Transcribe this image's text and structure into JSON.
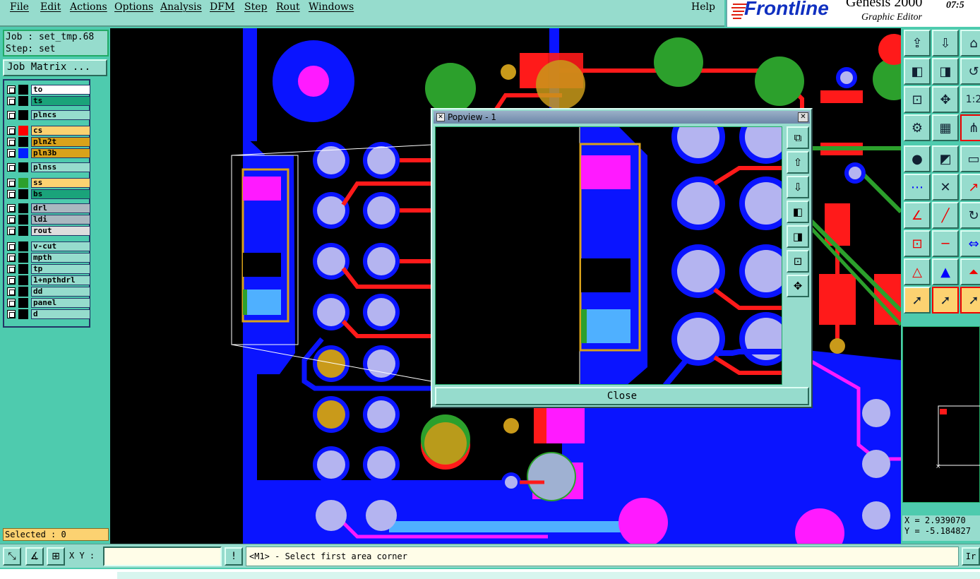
{
  "menu": {
    "items": [
      "File",
      "Edit",
      "Actions",
      "Options",
      "Analysis",
      "DFM",
      "Step",
      "Rout",
      "Windows"
    ],
    "help": "Help"
  },
  "brand": {
    "logo": "Frontline",
    "product": "Genesis 2000",
    "subtitle": "Graphic Editor",
    "clock": "07:5"
  },
  "job": {
    "job_line": "Job : set_tmp.68",
    "step_line": "Step: set",
    "matrix_button": "Job Matrix ..."
  },
  "layers": [
    {
      "name": "to",
      "bg": "#ffffff",
      "color": "#000000"
    },
    {
      "name": "ts",
      "bg": "#1aa37a",
      "color": "#000000"
    },
    {
      "name": "plncs",
      "bg": "#96dccd",
      "color": "#000000"
    },
    {
      "name": "cs",
      "bg": "#fcd271",
      "color": "#ff0000"
    },
    {
      "name": "pln2t",
      "bg": "#d9a21a",
      "color": "#000000"
    },
    {
      "name": "pln3b",
      "bg": "#d9a21a",
      "color": "#0020ff"
    },
    {
      "name": "plnss",
      "bg": "#96dccd",
      "color": "#000000"
    },
    {
      "name": "ss",
      "bg": "#fcd271",
      "color": "#2ca02c"
    },
    {
      "name": "bs",
      "bg": "#1aa37a",
      "color": "#000000"
    },
    {
      "name": "drl",
      "bg": "#aab8c0",
      "color": "#000000"
    },
    {
      "name": "ldi",
      "bg": "#aab8c0",
      "color": "#000000"
    },
    {
      "name": "rout",
      "bg": "#dddddd",
      "color": "#000000"
    },
    {
      "name": "v-cut",
      "bg": "#96dccd",
      "color": "#000000"
    },
    {
      "name": "mpth",
      "bg": "#96dccd",
      "color": "#000000"
    },
    {
      "name": "tp",
      "bg": "#96dccd",
      "color": "#000000"
    },
    {
      "name": "1+npthdrl",
      "bg": "#96dccd",
      "color": "#000000"
    },
    {
      "name": "dd",
      "bg": "#96dccd",
      "color": "#000000"
    },
    {
      "name": "panel",
      "bg": "#96dccd",
      "color": "#000000"
    },
    {
      "name": "d",
      "bg": "#96dccd",
      "color": "#000000"
    }
  ],
  "selected": "Selected : 0",
  "popview": {
    "title": "Popview - 1",
    "close_label": "Close",
    "close_x": "✕"
  },
  "coords": {
    "x": "X = 2.939070",
    "y": "Y = -5.184827"
  },
  "status": {
    "xy_label": "X Y :",
    "xy_value": "",
    "prompt": "<M1> - Select first area corner",
    "right_button": "Ir"
  },
  "colors": {
    "teal_panel": "#4ecbae",
    "light_teal": "#96dccd",
    "copper_blue": "#0a14ff",
    "pad_lavender": "#b4b4f0",
    "trace_red": "#ff1a1a",
    "silk_green": "#2ca02c",
    "gold": "#c99a1a",
    "magenta": "#ff1aff"
  }
}
